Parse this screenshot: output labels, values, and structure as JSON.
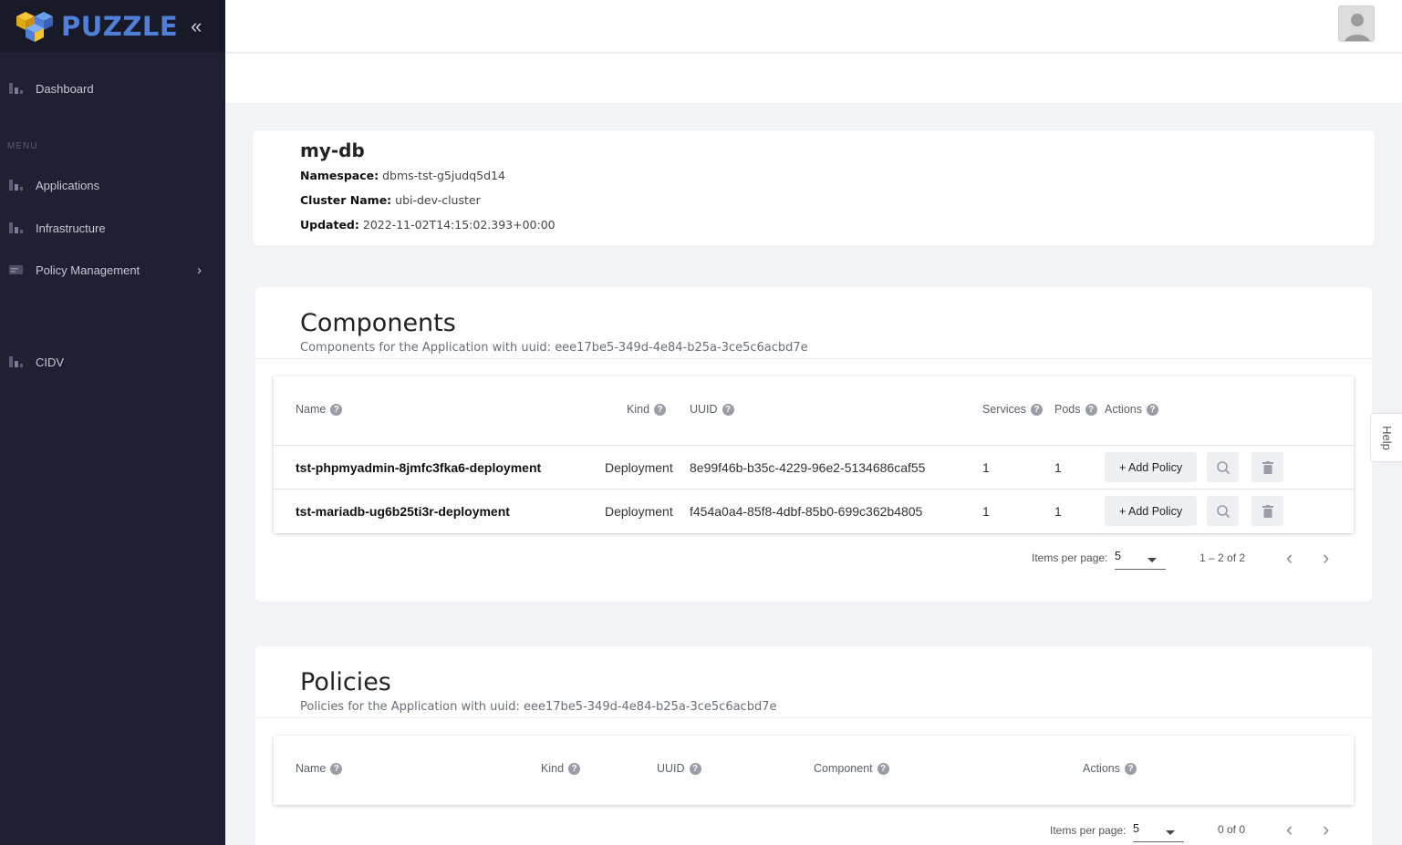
{
  "brand": {
    "name": "PUZZLE",
    "collapse_icon": "«"
  },
  "sidebar": {
    "menu_label": "MENU",
    "items": [
      {
        "label": "Dashboard"
      },
      {
        "label": "Applications"
      },
      {
        "label": "Infrastructure"
      },
      {
        "label": "Policy Management",
        "chevron": "›"
      },
      {
        "label": "CIDV"
      }
    ]
  },
  "app": {
    "name": "my-db",
    "namespace_label": "Namespace:",
    "namespace": "dbms-tst-g5judq5d14",
    "cluster_label": "Cluster Name:",
    "cluster": "ubi-dev-cluster",
    "updated_label": "Updated:",
    "updated": "2022-11-02T14:15:02.393+00:00"
  },
  "components": {
    "title": "Components",
    "subtitle": "Components for the Application with uuid: eee17be5-349d-4e84-b25a-3ce5c6acbd7e",
    "headers": {
      "name": "Name",
      "kind": "Kind",
      "uuid": "UUID",
      "services": "Services",
      "pods": "Pods",
      "actions": "Actions"
    },
    "rows": [
      {
        "name": "tst-phpmyadmin-8jmfc3fka6-deployment",
        "kind": "Deployment",
        "uuid": "8e99f46b-b35c-4229-96e2-5134686caf55",
        "services": "1",
        "pods": "1",
        "add_policy": "+ Add Policy"
      },
      {
        "name": "tst-mariadb-ug6b25ti3r-deployment",
        "kind": "Deployment",
        "uuid": "f454a0a4-85f8-4dbf-85b0-699c362b4805",
        "services": "1",
        "pods": "1",
        "add_policy": "+ Add Policy"
      }
    ],
    "pager": {
      "items_label": "Items per page:",
      "page_size": "5",
      "range": "1 – 2 of 2"
    }
  },
  "policies": {
    "title": "Policies",
    "subtitle": "Policies for the Application with uuid: eee17be5-349d-4e84-b25a-3ce5c6acbd7e",
    "headers": {
      "name": "Name",
      "kind": "Kind",
      "uuid": "UUID",
      "component": "Component",
      "actions": "Actions"
    },
    "pager": {
      "items_label": "Items per page:",
      "page_size": "5",
      "range": "0 of 0"
    }
  },
  "help_tab": "Help",
  "colors": {
    "sidebar_bg": "#1f2032",
    "brand_bg": "#191a28",
    "accent_blue": "#4f7fd8",
    "logo_yellow": "#f5c534"
  }
}
